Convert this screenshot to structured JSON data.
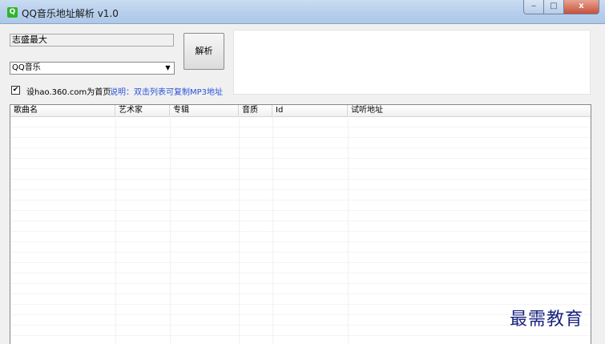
{
  "window": {
    "title": "QQ音乐地址解析 v1.0",
    "icon": "app-icon",
    "controls": {
      "minimize": "‒",
      "maximize": "□",
      "close": "x"
    }
  },
  "form": {
    "search_value": "志盛最大",
    "source_select": {
      "selected": "QQ音乐"
    },
    "parse_button_label": "解析",
    "homepage_checkbox": {
      "checked": true,
      "label": "设hao.360.com为首页"
    },
    "note": "说明：双击列表可复制MP3地址"
  },
  "list": {
    "columns": [
      "歌曲名",
      "艺术家",
      "专辑",
      "音质",
      "Id",
      "试听地址"
    ],
    "rows": []
  },
  "watermark": "最需教育",
  "colors": {
    "note": "#2a52d6",
    "watermark": "#1a237e",
    "close_button": "#c7503a"
  }
}
